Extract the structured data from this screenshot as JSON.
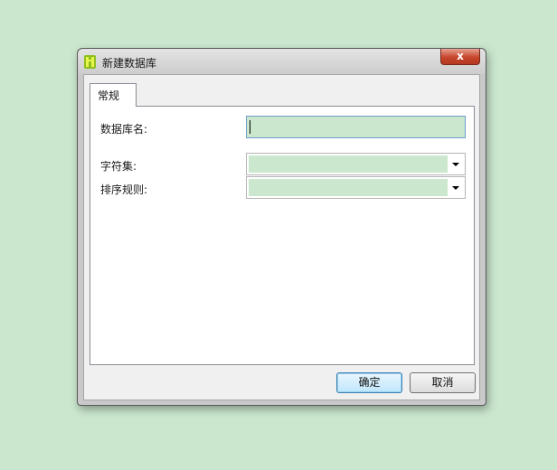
{
  "window": {
    "title": "新建数据库",
    "close_label": "x"
  },
  "tabs": [
    {
      "label": "常规",
      "selected": true
    }
  ],
  "form": {
    "database_name": {
      "label": "数据库名:",
      "value": ""
    },
    "charset": {
      "label": "字符集:",
      "value": ""
    },
    "collation": {
      "label": "排序规则:",
      "value": ""
    }
  },
  "buttons": {
    "ok": "确定",
    "cancel": "取消"
  },
  "colors": {
    "background": "#cbe8cf",
    "field_fill": "#cbe8cf",
    "close_button": "#c7462b"
  }
}
